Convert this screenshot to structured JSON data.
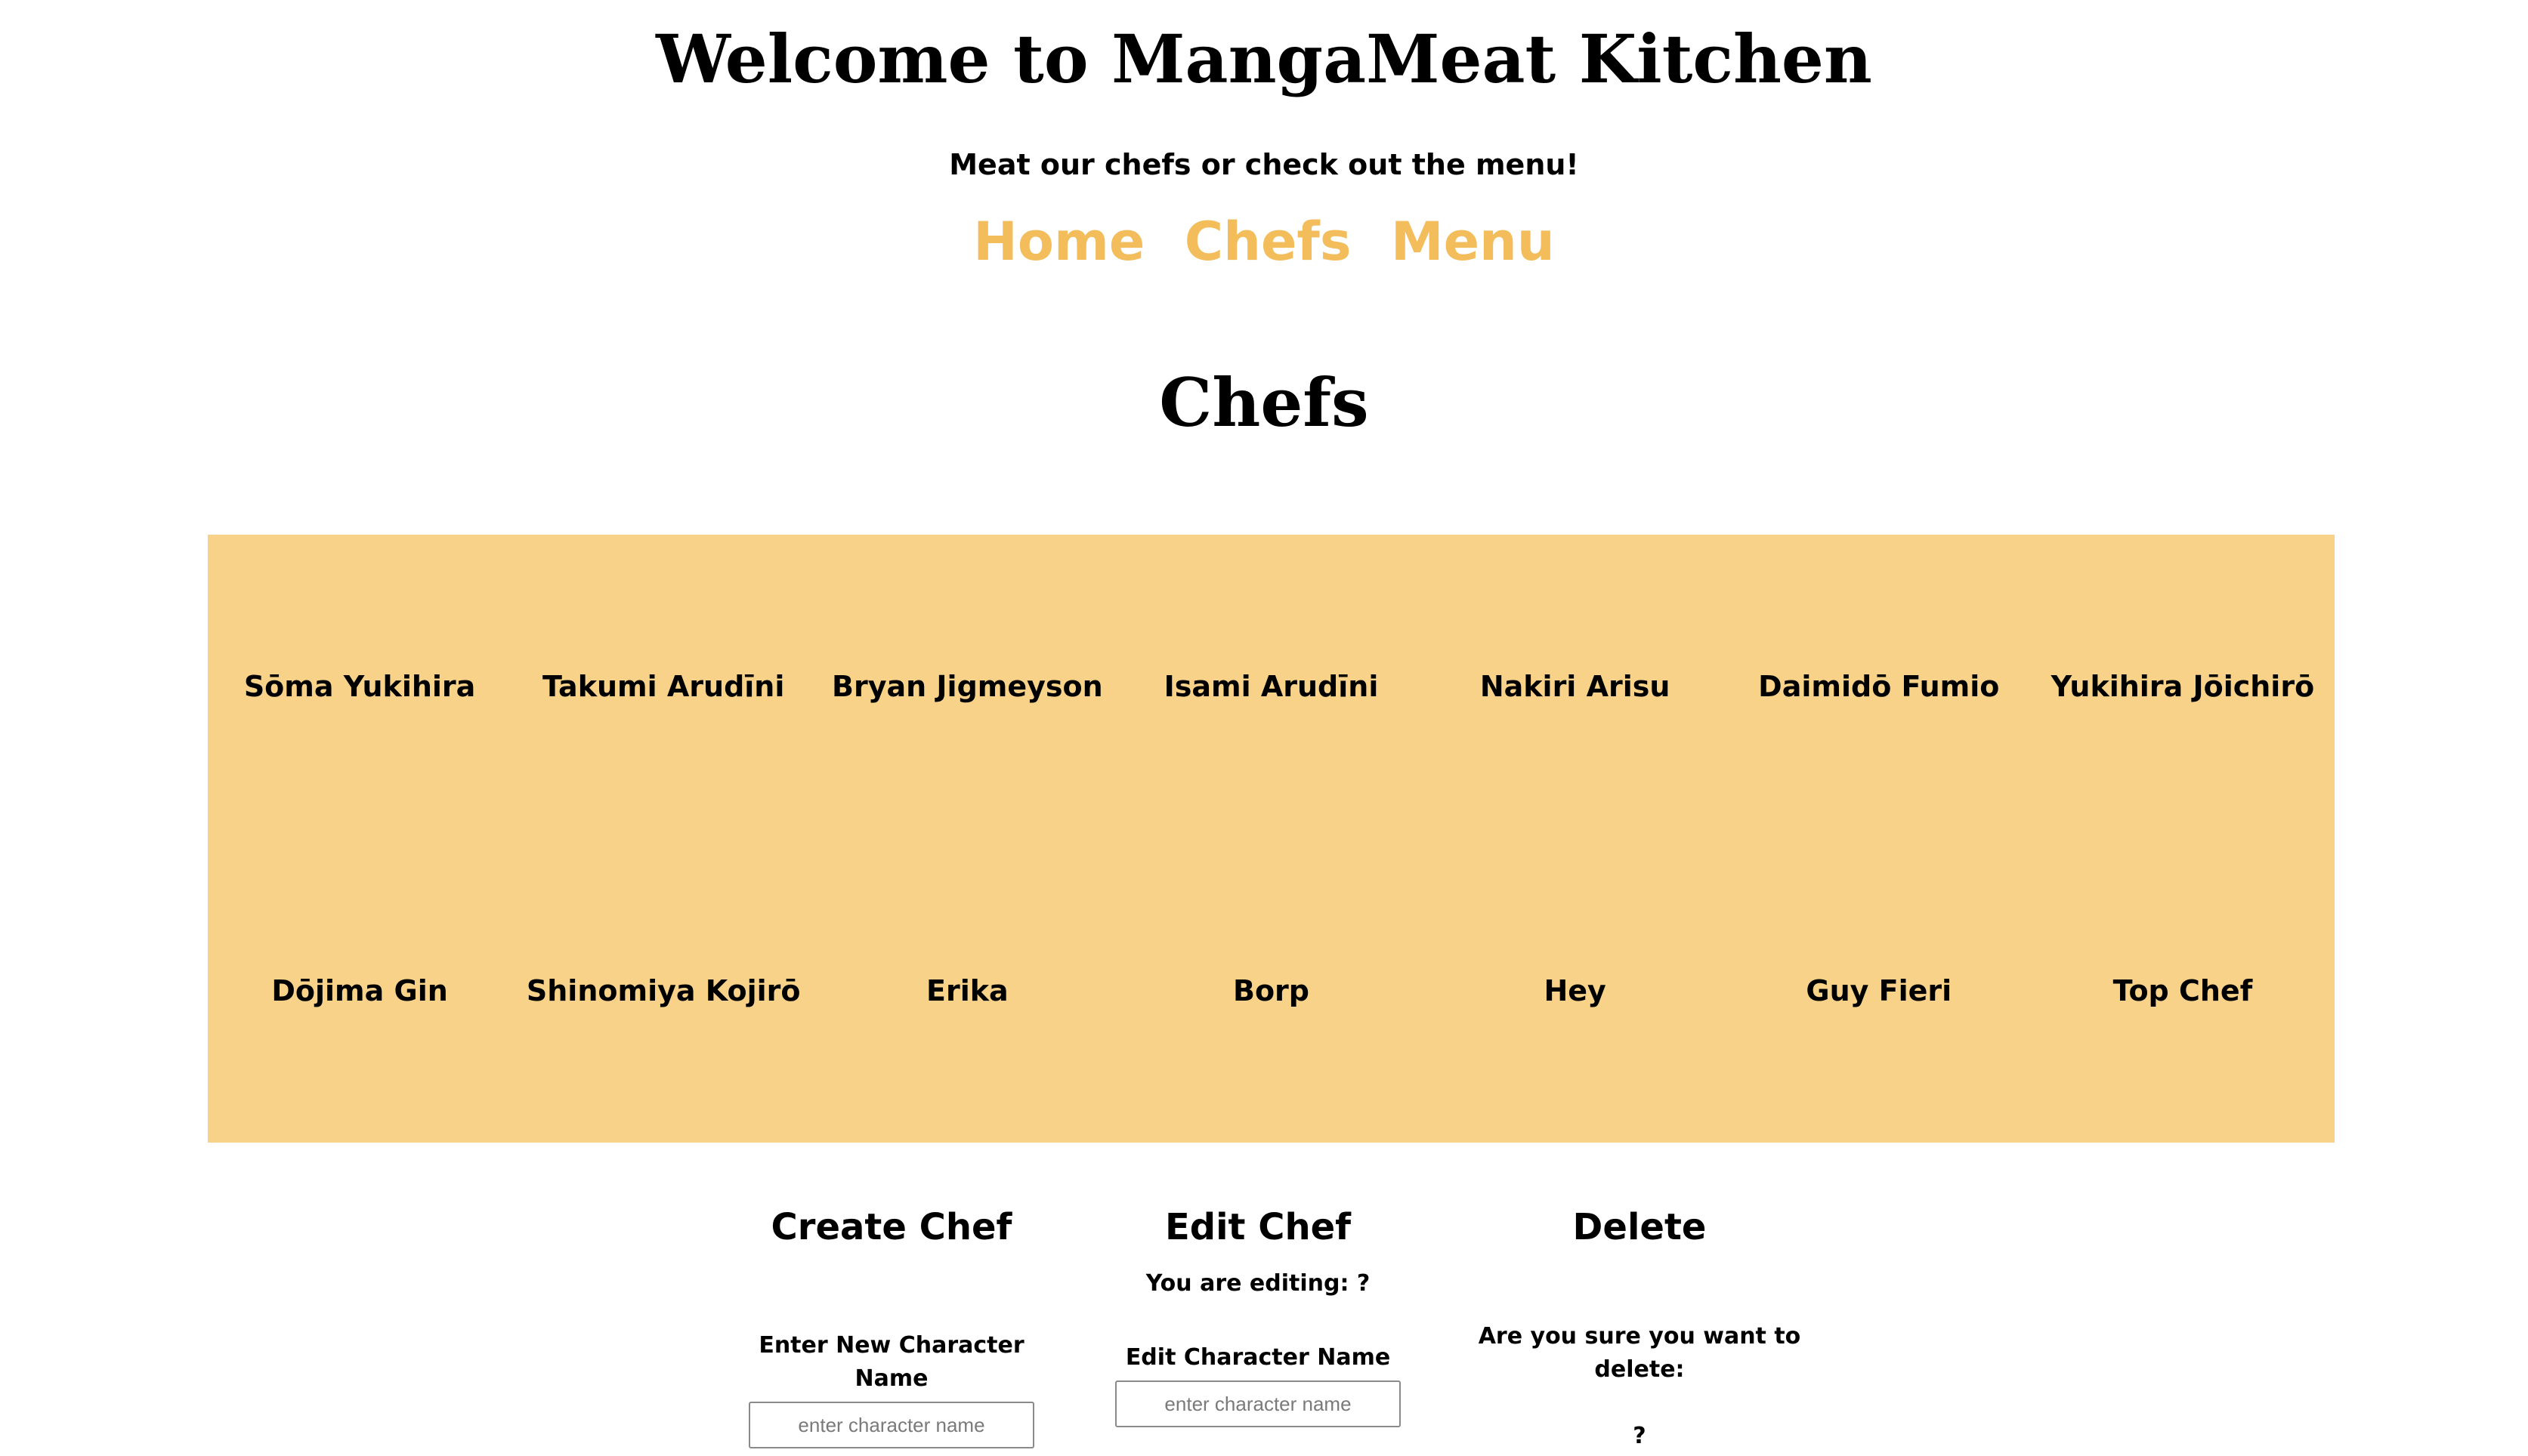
{
  "header": {
    "title": "Welcome to MangaMeat Kitchen",
    "tagline": "Meat our chefs or check out the menu!"
  },
  "nav": {
    "items": [
      "Home",
      "Chefs",
      "Menu"
    ]
  },
  "colors": {
    "nav_link": "#f2bd5a",
    "grid_background": "#f7d288"
  },
  "section": {
    "title": "Chefs"
  },
  "chefs": [
    "Sōma Yukihira",
    "Takumi Arudīni",
    "Bryan Jigmeyson",
    "Isami Arudīni",
    "Nakiri Arisu",
    "Daimidō Fumio",
    "Yukihira Jōichirō",
    "Dōjima Gin",
    "Shinomiya Kojirō",
    "Erika",
    "Borp",
    "Hey",
    "Guy Fieri",
    "Top Chef"
  ],
  "create": {
    "title": "Create Chef",
    "label": "Enter New Character Name",
    "placeholder": "enter character name"
  },
  "edit": {
    "title": "Edit Chef",
    "editing_label": "You are editing: ?",
    "label": "Edit Character Name",
    "placeholder": "enter character name"
  },
  "delete": {
    "title": "Delete",
    "confirm_label": "Are you sure you want to delete:",
    "target": "?"
  }
}
